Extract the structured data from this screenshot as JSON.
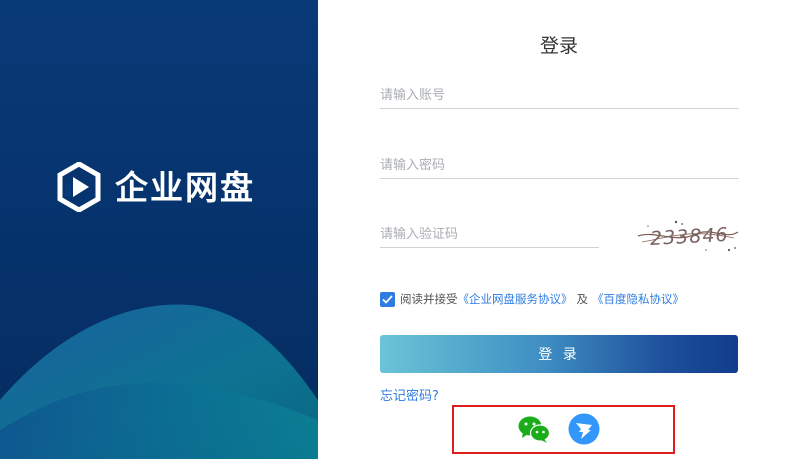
{
  "brand": {
    "name": "企业网盘",
    "logo_icon": "hexagon-play-logo-icon",
    "background_color": "#093a78"
  },
  "login": {
    "title": "登录",
    "account_placeholder": "请输入账号",
    "password_placeholder": "请输入密码",
    "captcha_placeholder": "请输入验证码",
    "captcha_text": "233846",
    "agreement": {
      "checked": true,
      "prefix": "阅读并接受",
      "service_link": "《企业网盘服务协议》",
      "separator": "及",
      "privacy_link": "《百度隐私协议》"
    },
    "submit_label": "登 录",
    "forgot_label": "忘记密码?"
  },
  "third_party": {
    "icons": [
      "wechat-icon",
      "dingtalk-icon"
    ],
    "highlight_color": "#e01c1c"
  },
  "colors": {
    "accent": "#2f7de1",
    "button_start": "#6bc4d6",
    "button_end": "#103d8c"
  }
}
